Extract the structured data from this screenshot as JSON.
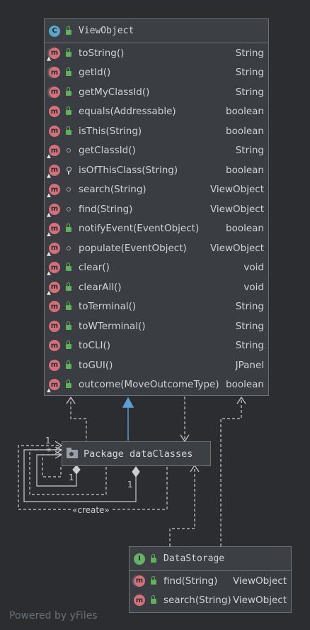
{
  "view_object": {
    "name": "ViewObject",
    "icon": "class-icon",
    "methods": [
      {
        "name": "toString()",
        "type": "String",
        "vis": "public",
        "kind": "abstract-override"
      },
      {
        "name": "getId()",
        "type": "String",
        "vis": "public",
        "kind": "abstract"
      },
      {
        "name": "getMyClassId()",
        "type": "String",
        "vis": "public",
        "kind": "abstract"
      },
      {
        "name": "equals(Addressable)",
        "type": "boolean",
        "vis": "public",
        "kind": "plain"
      },
      {
        "name": "isThis(String)",
        "type": "boolean",
        "vis": "public",
        "kind": "plain"
      },
      {
        "name": "getClassId()",
        "type": "String",
        "vis": "package",
        "kind": "override"
      },
      {
        "name": "isOfThisClass(String)",
        "type": "boolean",
        "vis": "private",
        "kind": "override"
      },
      {
        "name": "search(String)",
        "type": "ViewObject",
        "vis": "package",
        "kind": "override"
      },
      {
        "name": "find(String)",
        "type": "ViewObject",
        "vis": "package",
        "kind": "override"
      },
      {
        "name": "notifyEvent(EventObject)",
        "type": "boolean",
        "vis": "public",
        "kind": "override"
      },
      {
        "name": "populate(EventObject)",
        "type": "ViewObject",
        "vis": "package",
        "kind": "override"
      },
      {
        "name": "clear()",
        "type": "void",
        "vis": "public",
        "kind": "override"
      },
      {
        "name": "clearAll()",
        "type": "void",
        "vis": "public",
        "kind": "override"
      },
      {
        "name": "toTerminal()",
        "type": "String",
        "vis": "public",
        "kind": "plain"
      },
      {
        "name": "toWTerminal()",
        "type": "String",
        "vis": "public",
        "kind": "plain"
      },
      {
        "name": "toCLI()",
        "type": "String",
        "vis": "public",
        "kind": "plain"
      },
      {
        "name": "toGUI()",
        "type": "JPanel",
        "vis": "public",
        "kind": "plain"
      },
      {
        "name": "outcome(MoveOutcomeType)",
        "type": "boolean",
        "vis": "public",
        "kind": "override"
      }
    ]
  },
  "package_node": {
    "name": "Package dataClasses",
    "icon": "package-icon"
  },
  "data_storage": {
    "name": "DataStorage",
    "icon": "interface-icon",
    "methods": [
      {
        "name": "find(String)",
        "type": "ViewObject",
        "vis": "public",
        "kind": "abstract"
      },
      {
        "name": "search(String)",
        "type": "ViewObject",
        "vis": "public",
        "kind": "plain"
      }
    ]
  },
  "labels": {
    "create": "«create»",
    "mult_1a": "1",
    "mult_star": "*",
    "mult_1b": "1",
    "mult_1c": "1"
  },
  "footer": "Powered by yFiles",
  "colors": {
    "background": "#2b2d30",
    "node_fill": "#3a3d41",
    "method_badge": "#d4707a",
    "class_badge": "#5aa6c8",
    "interface_badge": "#64b365",
    "inheritance_edge": "#5a9fd6"
  }
}
